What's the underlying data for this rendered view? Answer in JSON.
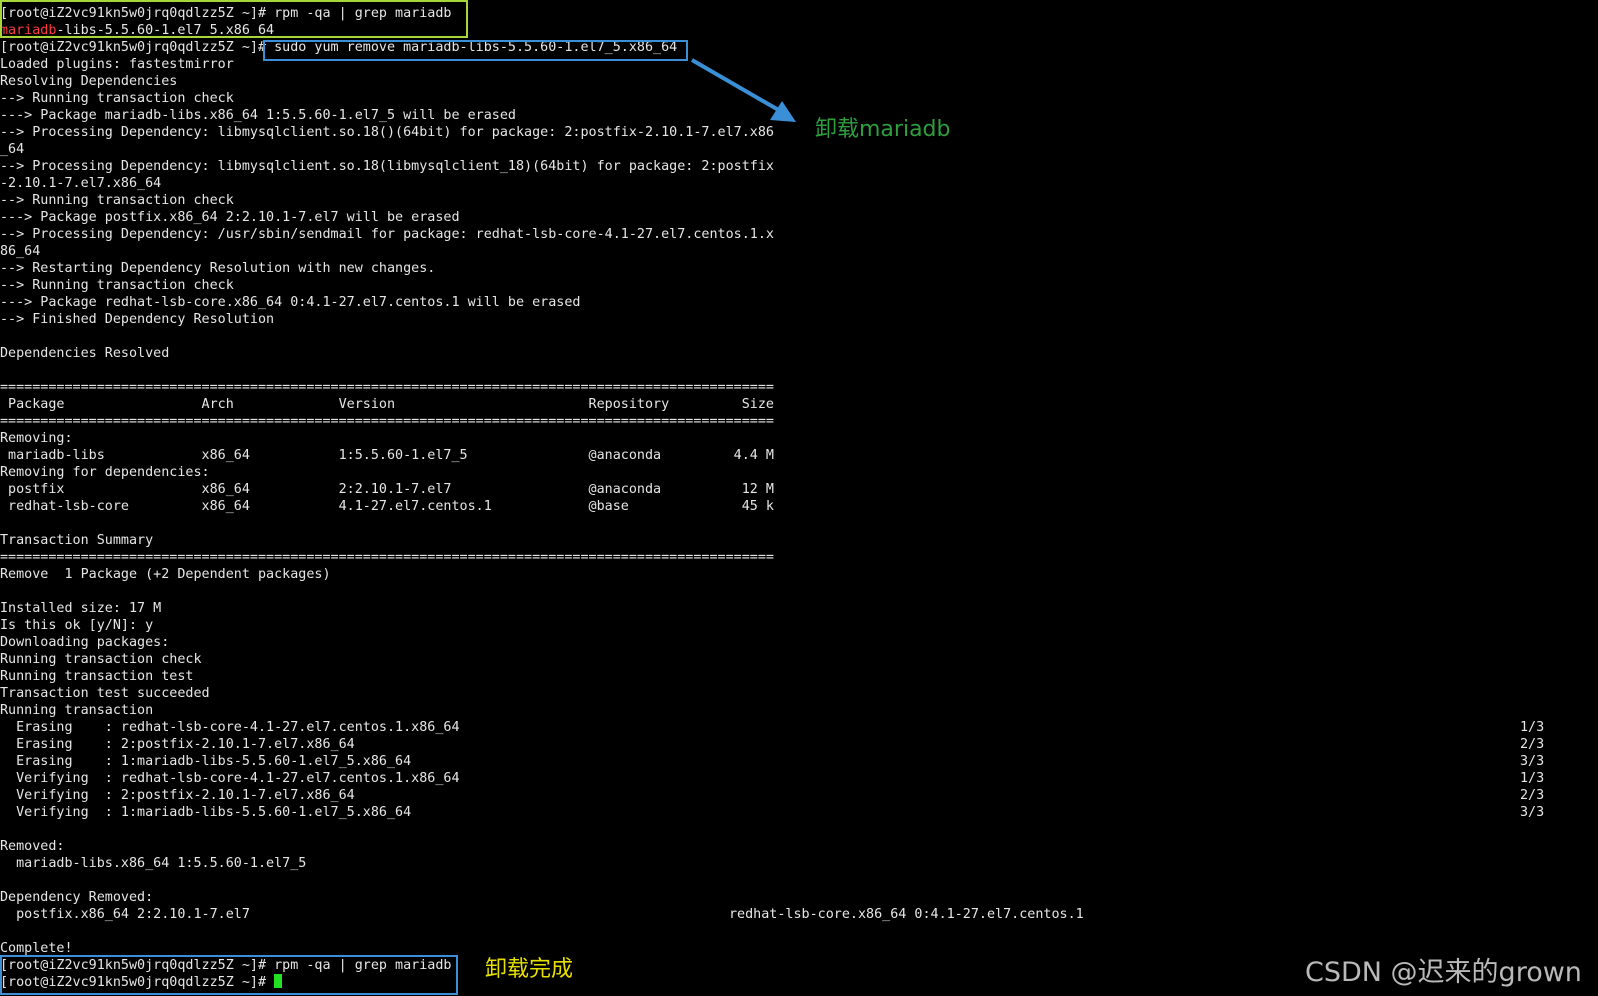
{
  "terminal": {
    "lines": [
      "[root@iZ2vc91kn5w0jrq0qdlzz5Z ~]# rpm -qa | grep mariadb",
      "mariadb-libs-5.5.60-1.el7_5.x86_64",
      "[root@iZ2vc91kn5w0jrq0qdlzz5Z ~]# sudo yum remove mariadb-libs-5.5.60-1.el7_5.x86_64",
      "Loaded plugins: fastestmirror",
      "Resolving Dependencies",
      "--> Running transaction check",
      "---> Package mariadb-libs.x86_64 1:5.5.60-1.el7_5 will be erased",
      "--> Processing Dependency: libmysqlclient.so.18()(64bit) for package: 2:postfix-2.10.1-7.el7.x86",
      "_64",
      "--> Processing Dependency: libmysqlclient.so.18(libmysqlclient_18)(64bit) for package: 2:postfix",
      "-2.10.1-7.el7.x86_64",
      "--> Running transaction check",
      "---> Package postfix.x86_64 2:2.10.1-7.el7 will be erased",
      "--> Processing Dependency: /usr/sbin/sendmail for package: redhat-lsb-core-4.1-27.el7.centos.1.x",
      "86_64",
      "--> Restarting Dependency Resolution with new changes.",
      "--> Running transaction check",
      "---> Package redhat-lsb-core.x86_64 0:4.1-27.el7.centos.1 will be erased",
      "--> Finished Dependency Resolution",
      "",
      "Dependencies Resolved",
      "",
      "================================================================================================",
      " Package                 Arch             Version                        Repository         Size",
      "================================================================================================",
      "Removing:",
      " mariadb-libs            x86_64           1:5.5.60-1.el7_5               @anaconda         4.4 M",
      "Removing for dependencies:",
      " postfix                 x86_64           2:2.10.1-7.el7                 @anaconda          12 M",
      " redhat-lsb-core         x86_64           4.1-27.el7.centos.1            @base              45 k",
      "",
      "Transaction Summary",
      "================================================================================================",
      "Remove  1 Package (+2 Dependent packages)",
      "",
      "Installed size: 17 M",
      "Is this ok [y/N]: y",
      "Downloading packages:",
      "Running transaction check",
      "Running transaction test",
      "Transaction test succeeded",
      "Running transaction",
      "  Erasing    : redhat-lsb-core-4.1-27.el7.centos.1.x86_64",
      "  Erasing    : 2:postfix-2.10.1-7.el7.x86_64",
      "  Erasing    : 1:mariadb-libs-5.5.60-1.el7_5.x86_64",
      "  Verifying  : redhat-lsb-core-4.1-27.el7.centos.1.x86_64",
      "  Verifying  : 2:postfix-2.10.1-7.el7.x86_64",
      "  Verifying  : 1:mariadb-libs-5.5.60-1.el7_5.x86_64",
      "",
      "Removed:",
      "  mariadb-libs.x86_64 1:5.5.60-1.el7_5",
      "",
      "Dependency Removed:",
      "  postfix.x86_64 2:2.10.1-7.el7",
      "",
      "Complete!",
      "[root@iZ2vc91kn5w0jrq0qdlzz5Z ~]# rpm -qa | grep mariadb",
      "[root@iZ2vc91kn5w0jrq0qdlzz5Z ~]# "
    ],
    "highlight_prefix": "mariadb",
    "progress": [
      "1/3",
      "2/3",
      "3/3",
      "1/3",
      "2/3",
      "3/3"
    ],
    "dependency_removed_extra": "redhat-lsb-core.x86_64 0:4.1-27.el7.centos.1"
  },
  "annotations": {
    "uninstall_label": "卸载mariadb",
    "uninstall_done_label": "卸载完成",
    "watermark": "CSDN @迟来的grown"
  },
  "colors": {
    "green_box": "#a6d63a",
    "blue_box": "#3a8fd6",
    "arrow": "#3a8fd6",
    "label_green": "#2e9e3e",
    "label_yellow": "#e6e000",
    "highlight_text": "#ff3b3b",
    "cursor": "#22e022"
  }
}
